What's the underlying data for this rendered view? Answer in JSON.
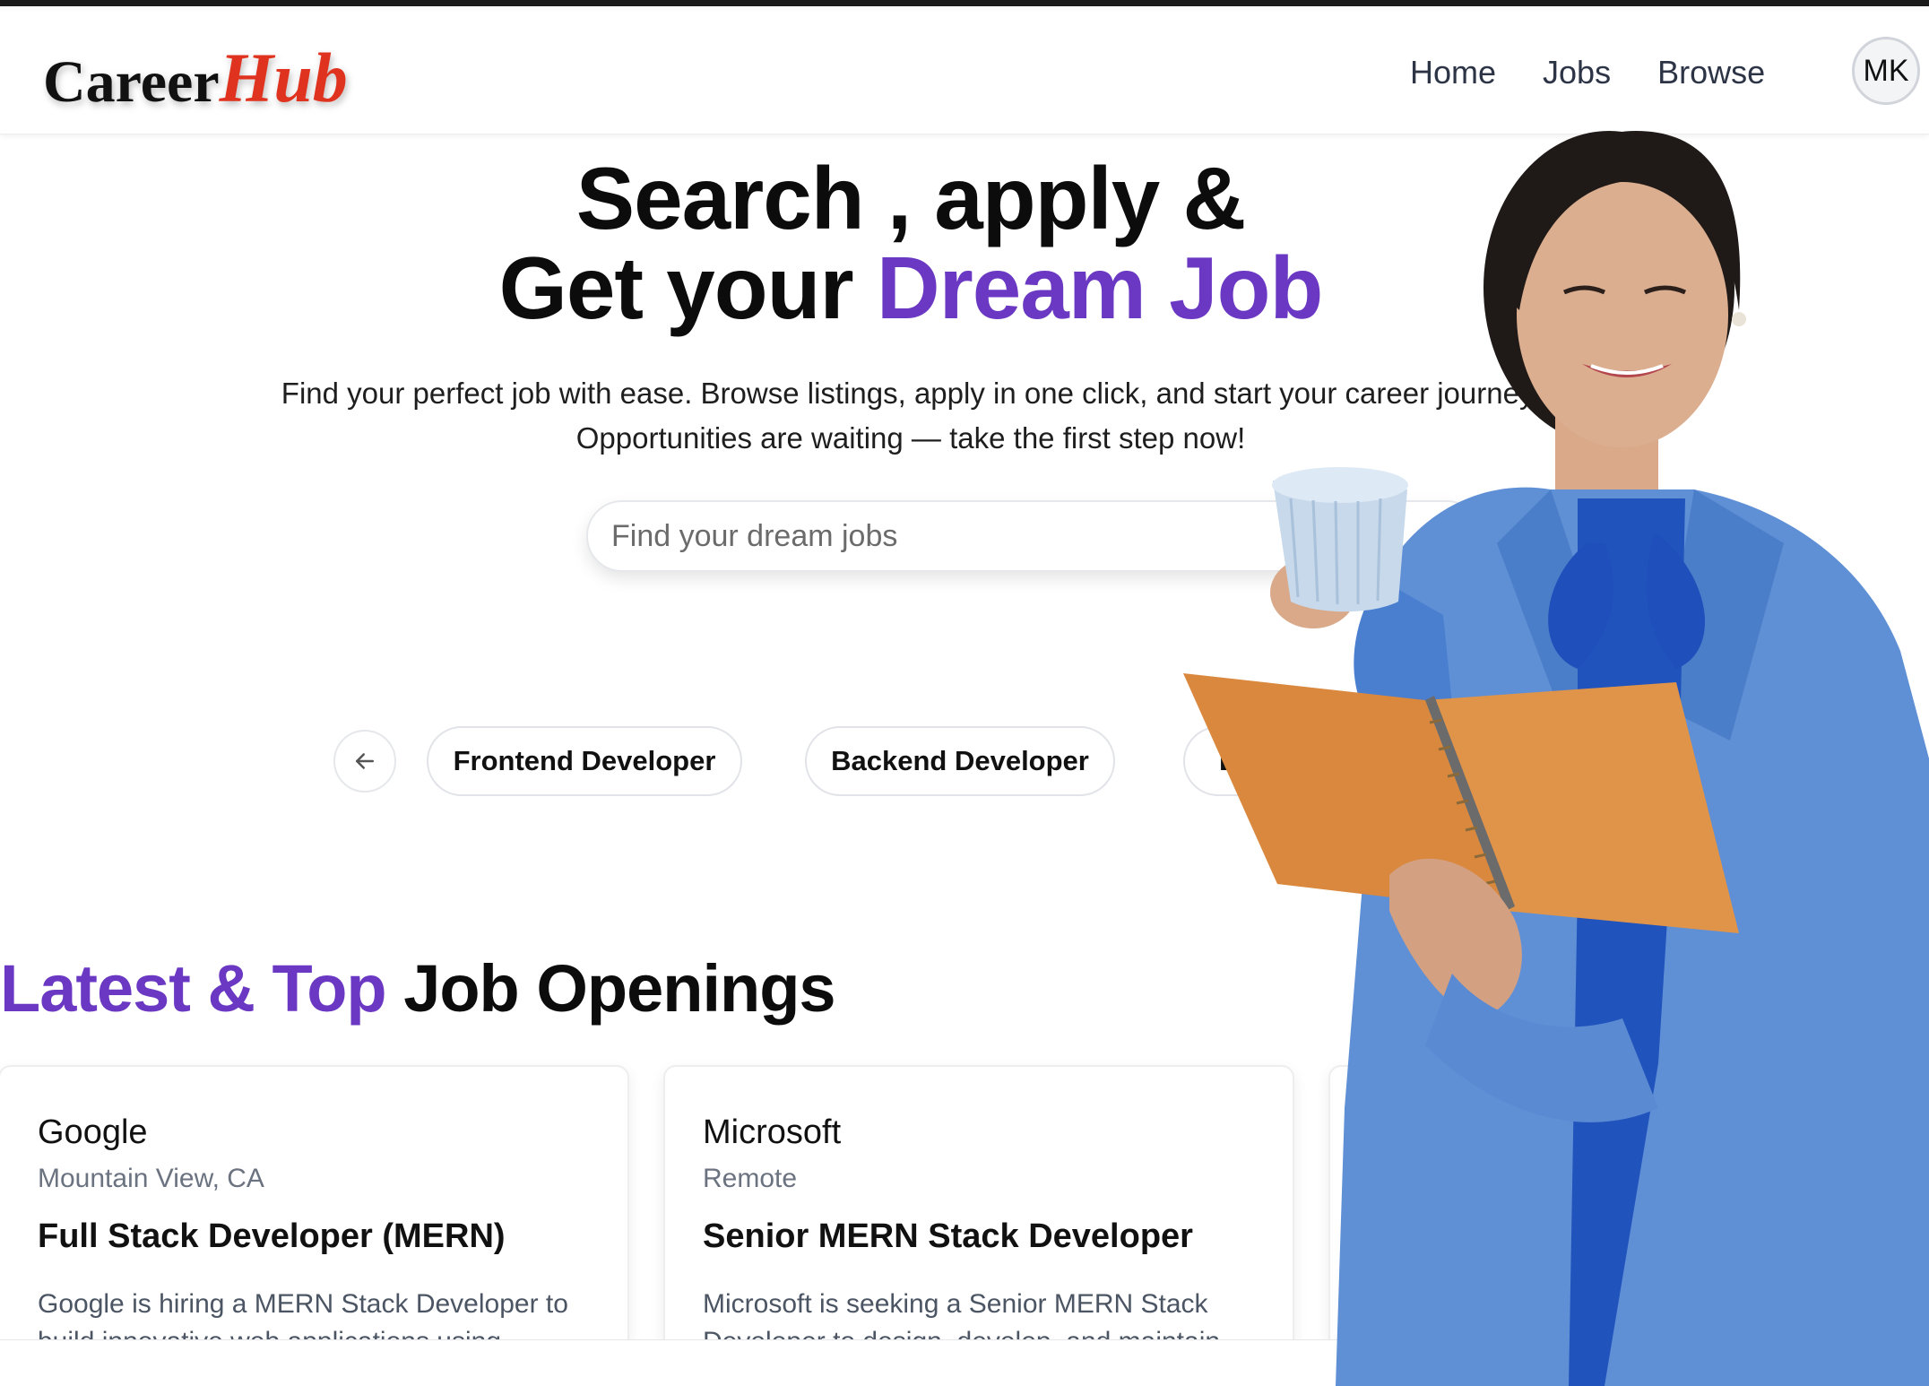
{
  "brand": {
    "part1": "Career",
    "part2": "Hub"
  },
  "nav": {
    "items": [
      "Home",
      "Jobs",
      "Browse"
    ],
    "avatar_initials": "MK"
  },
  "hero": {
    "line1": "Search , apply &",
    "line2_prefix": "Get your ",
    "line2_accent": "Dream Job",
    "subtitle_line1": "Find your perfect job with ease. Browse listings, apply in one click, and start your career journey.",
    "subtitle_line2": "Opportunities are waiting — take the first step now!"
  },
  "search": {
    "placeholder": "Find your dream jobs"
  },
  "categories": {
    "items": [
      "Frontend Developer",
      "Backend Developer",
      "D"
    ]
  },
  "section": {
    "title_accent": "Latest & Top",
    "title_rest": " Job Openings"
  },
  "jobs": [
    {
      "company": "Google",
      "location": "Mountain View, CA",
      "title": "Full Stack Developer (MERN)",
      "description": "Google is hiring a MERN Stack Developer to build innovative web applications using"
    },
    {
      "company": "Microsoft",
      "location": "Remote",
      "title": "Senior MERN Stack Developer",
      "description": "Microsoft is seeking a Senior MERN Stack Developer to design, develop, and maintain"
    }
  ],
  "colors": {
    "accent": "#6a38c2",
    "logo_red": "#e0331f",
    "text": "#111111",
    "muted": "#6b7280"
  },
  "icons": {
    "carousel_prev": "arrow-left-icon"
  }
}
